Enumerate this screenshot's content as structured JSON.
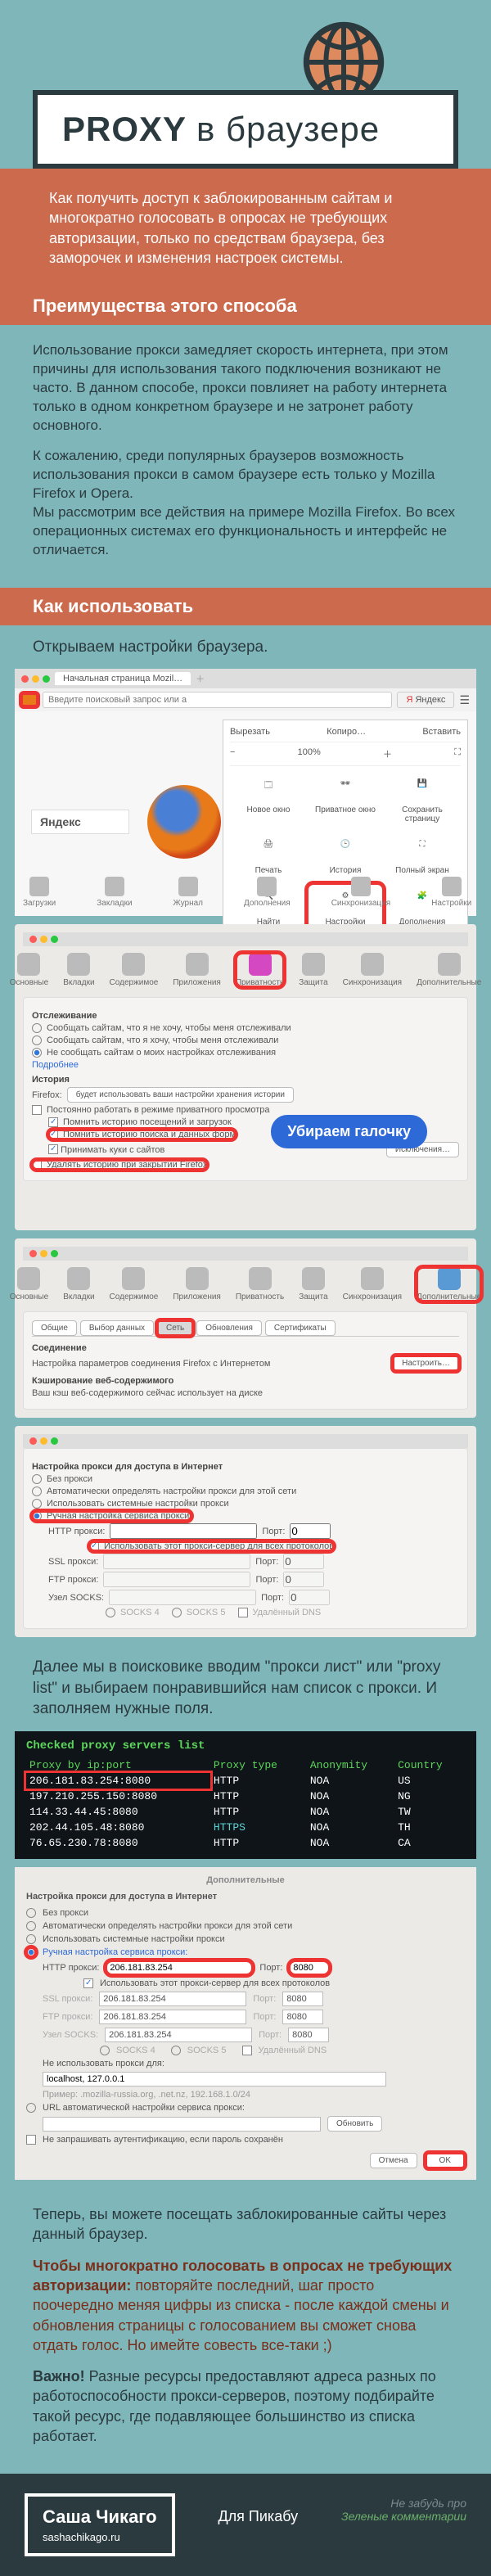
{
  "header": {
    "title_strong": "PROXY",
    "title_rest": "в браузере"
  },
  "intro": "Как получить доступ к заблокированным сайтам и многократно голосовать в опросах не требующих авторизации, только по средствам браузера, без заморочек и изменения настроек системы.",
  "adv_heading": "Преимущества этого способа",
  "adv_p1": "Использование прокси замедляет скорость интернета, при этом причины для использования такого подключения возникают не часто. В данном способе, прокси повлияет на работу интернета только в одном конкретном браузере и не затронет работу основного.",
  "adv_p2_a": "К сожалению, среди популярных браузеров возможность использования прокси в самом браузере есть только у Mozilla Firefox и Opera.",
  "adv_p2_b": "Мы рассмотрим все действия на примере Mozilla Firefox. Во всех операционных системах его функциональность и интерфейс не отличается.",
  "howto_heading": "Как использовать",
  "step1": "Открываем настройки браузера.",
  "ff_window": {
    "tab_title": "Начальная страница Mozil…",
    "search_placeholder": "Введите поисковый запрос или а",
    "yandex": "Яндекс",
    "menu_top": {
      "cut": "Вырезать",
      "copy": "Копиро…",
      "paste": "Вставить",
      "zoom": "100%"
    },
    "menu_items": [
      "Новое окно",
      "Приватное окно",
      "Сохранить страницу",
      "Печать",
      "История",
      "Полный экран",
      "Найти",
      "Настройки",
      "Дополнения"
    ],
    "bottom_icons": [
      "Загрузки",
      "Закладки",
      "Журнал",
      "Дополнения",
      "Синхронизация",
      "Настройки"
    ]
  },
  "pref1": {
    "tabs": [
      "Основные",
      "Вкладки",
      "Содержимое",
      "Приложения",
      "Приватность",
      "Защита",
      "Синхронизация",
      "Дополнительные"
    ],
    "section1": "Отслеживание",
    "cb1": "Сообщать сайтам, что я не хочу, чтобы меня отслеживали",
    "cb2": "Сообщать сайтам, что я хочу, чтобы меня отслеживали",
    "cb3": "Не сообщать сайтам о моих настройках отслеживания",
    "link": "Подробнее",
    "section2": "История",
    "sel_lbl": "Firefox:",
    "sel_val": "будет использовать ваши настройки хранения истории",
    "cb_priv": "Постоянно работать в режиме приватного просмотра",
    "cb_hist": "Помнить историю посещений и загрузок",
    "cb_form": "Помнить историю поиска и данных форм",
    "cb_cookie": "Принимать куки с сайтов",
    "btn_exc": "Исключения…",
    "row_del": "Удалять историю при закрытии Firefox"
  },
  "callout_remove": "Убираем галочку",
  "pref2": {
    "tabs_active": "Дополнительные",
    "subtabs": [
      "Общие",
      "Выбор данных",
      "Сеть",
      "Обновления",
      "Сертификаты"
    ],
    "section": "Соединение",
    "desc": "Настройка параметров соединения Firefox с Интернетом",
    "btn": "Настроить…",
    "section2": "Кэширование веб-содержимого",
    "desc2": "Ваш кэш веб-содержимого сейчас использует на диске"
  },
  "pref3": {
    "title": "Настройка прокси для доступа в Интернет",
    "r1": "Без прокси",
    "r2": "Автоматически определять настройки прокси для этой сети",
    "r3": "Использовать системные настройки прокси",
    "r4": "Ручная настройка сервиса прокси:",
    "http": "HTTP прокси:",
    "port": "Порт:",
    "samecb": "Использовать этот прокси-сервер для всех протоколов",
    "ssl": "SSL прокси:",
    "ftp": "FTP прокси:",
    "socks": "Узел SOCKS:",
    "socks_v": [
      "SOCKS 4",
      "SOCKS 5"
    ],
    "remote_dns": "Удалённый DNS"
  },
  "step2": "Далее мы в поисковике вводим \"прокси лист\" или \"proxy list\"  и выбираем понравившийся нам список с прокси. И заполняем нужные поля.",
  "proxy_list": {
    "heading": "Checked proxy servers list",
    "cols": [
      "Proxy by ip:port",
      "Proxy type",
      "Anonymity",
      "Country"
    ],
    "rows": [
      {
        "ip": "206.181.83.254:8080",
        "type": "HTTP",
        "anon": "NOA",
        "cc": "US"
      },
      {
        "ip": "197.210.255.150:8080",
        "type": "HTTP",
        "anon": "NOA",
        "cc": "NG"
      },
      {
        "ip": "114.33.44.45:8080",
        "type": "HTTP",
        "anon": "NOA",
        "cc": "TW"
      },
      {
        "ip": "202.44.105.48:8080",
        "type": "HTTPS",
        "anon": "NOA",
        "cc": "TH"
      },
      {
        "ip": "76.65.230.78:8080",
        "type": "HTTP",
        "anon": "NOA",
        "cc": "CA"
      }
    ]
  },
  "proxy_conf": {
    "title": "Настройка прокси для доступа в Интернет",
    "http_val": "206.181.83.254",
    "port_val": "8080",
    "noproxy_lbl": "Не использовать прокси для:",
    "noproxy_val": "localhost, 127.0.0.1",
    "example": "Пример: .mozilla-russia.org, .net.nz, 192.168.1.0/24",
    "auto_url": "URL автоматической настройки сервиса прокси:",
    "reload": "Обновить",
    "no_auth": "Не запрашивать аутентификацию, если пароль сохранён",
    "cancel": "Отмена",
    "ok": "OK"
  },
  "outro": {
    "p1": "Теперь, вы можете посещать заблокированные сайты через данный браузер.",
    "p2_lead": "Чтобы многократно голосовать в опросах не требующих авторизации:",
    "p2_rest": " повторяйте последний, шаг просто поочередно меняя цифры из списка - после каждой смены и обновления страницы с голосованием вы сможет снова отдать голос. Но имейте совесть все-таки ;)",
    "p3_lead": "Важно!",
    "p3_rest": "  Разные ресурсы предоставляют адреса разных по работоспособности прокси-серверов, поэтому подбирайте такой ресурс, где подавляющее большинство из списка работает."
  },
  "footer": {
    "author": "Саша Чикаго",
    "site": "sashachikаgo.ru",
    "for": "Для Пикабу",
    "note1": "Не забудь про",
    "note2": "Зеленые комментарии"
  }
}
